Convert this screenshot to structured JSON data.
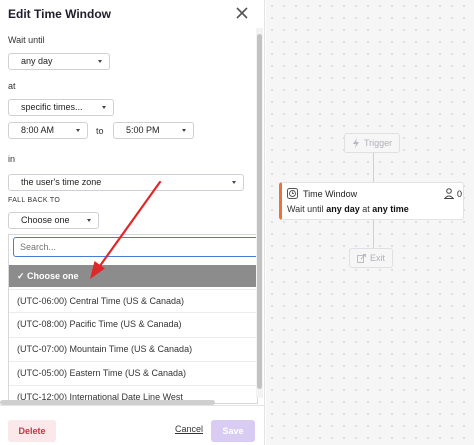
{
  "panel": {
    "title": "Edit Time Window",
    "wait_until_label": "Wait until",
    "day_select": "any day",
    "at_label": "at",
    "time_mode_select": "specific times...",
    "start_time": "8:00 AM",
    "to_label": "to",
    "end_time": "5:00 PM",
    "in_label": "in",
    "timezone_select": "the user's time zone",
    "fallback_label": "FALL BACK TO",
    "fallback_select": "Choose one"
  },
  "dropdown": {
    "search_placeholder": "Search...",
    "options": [
      "✓  Choose one",
      "(UTC-06:00) Central Time (US & Canada)",
      "(UTC-08:00) Pacific Time (US & Canada)",
      "(UTC-07:00) Mountain Time (US & Canada)",
      "(UTC-05:00) Eastern Time (US & Canada)",
      "(UTC-12:00) International Date Line West"
    ]
  },
  "footer": {
    "delete_label": "Delete",
    "cancel_label": "Cancel",
    "save_label": "Save"
  },
  "canvas": {
    "trigger_label": "Trigger",
    "card_title": "Time Window",
    "card_count": "0",
    "card_desc_1": "Wait until ",
    "card_desc_any_day": "any day",
    "card_desc_2": " at ",
    "card_desc_any_time": "any time",
    "exit_label": "Exit"
  },
  "colors": {
    "accent_orange": "#e8733c",
    "arrow_red": "#e0282a",
    "focus_blue": "#4a7bd8",
    "save_disabled": "#d9ccf3",
    "delete_text": "#c0364a"
  }
}
